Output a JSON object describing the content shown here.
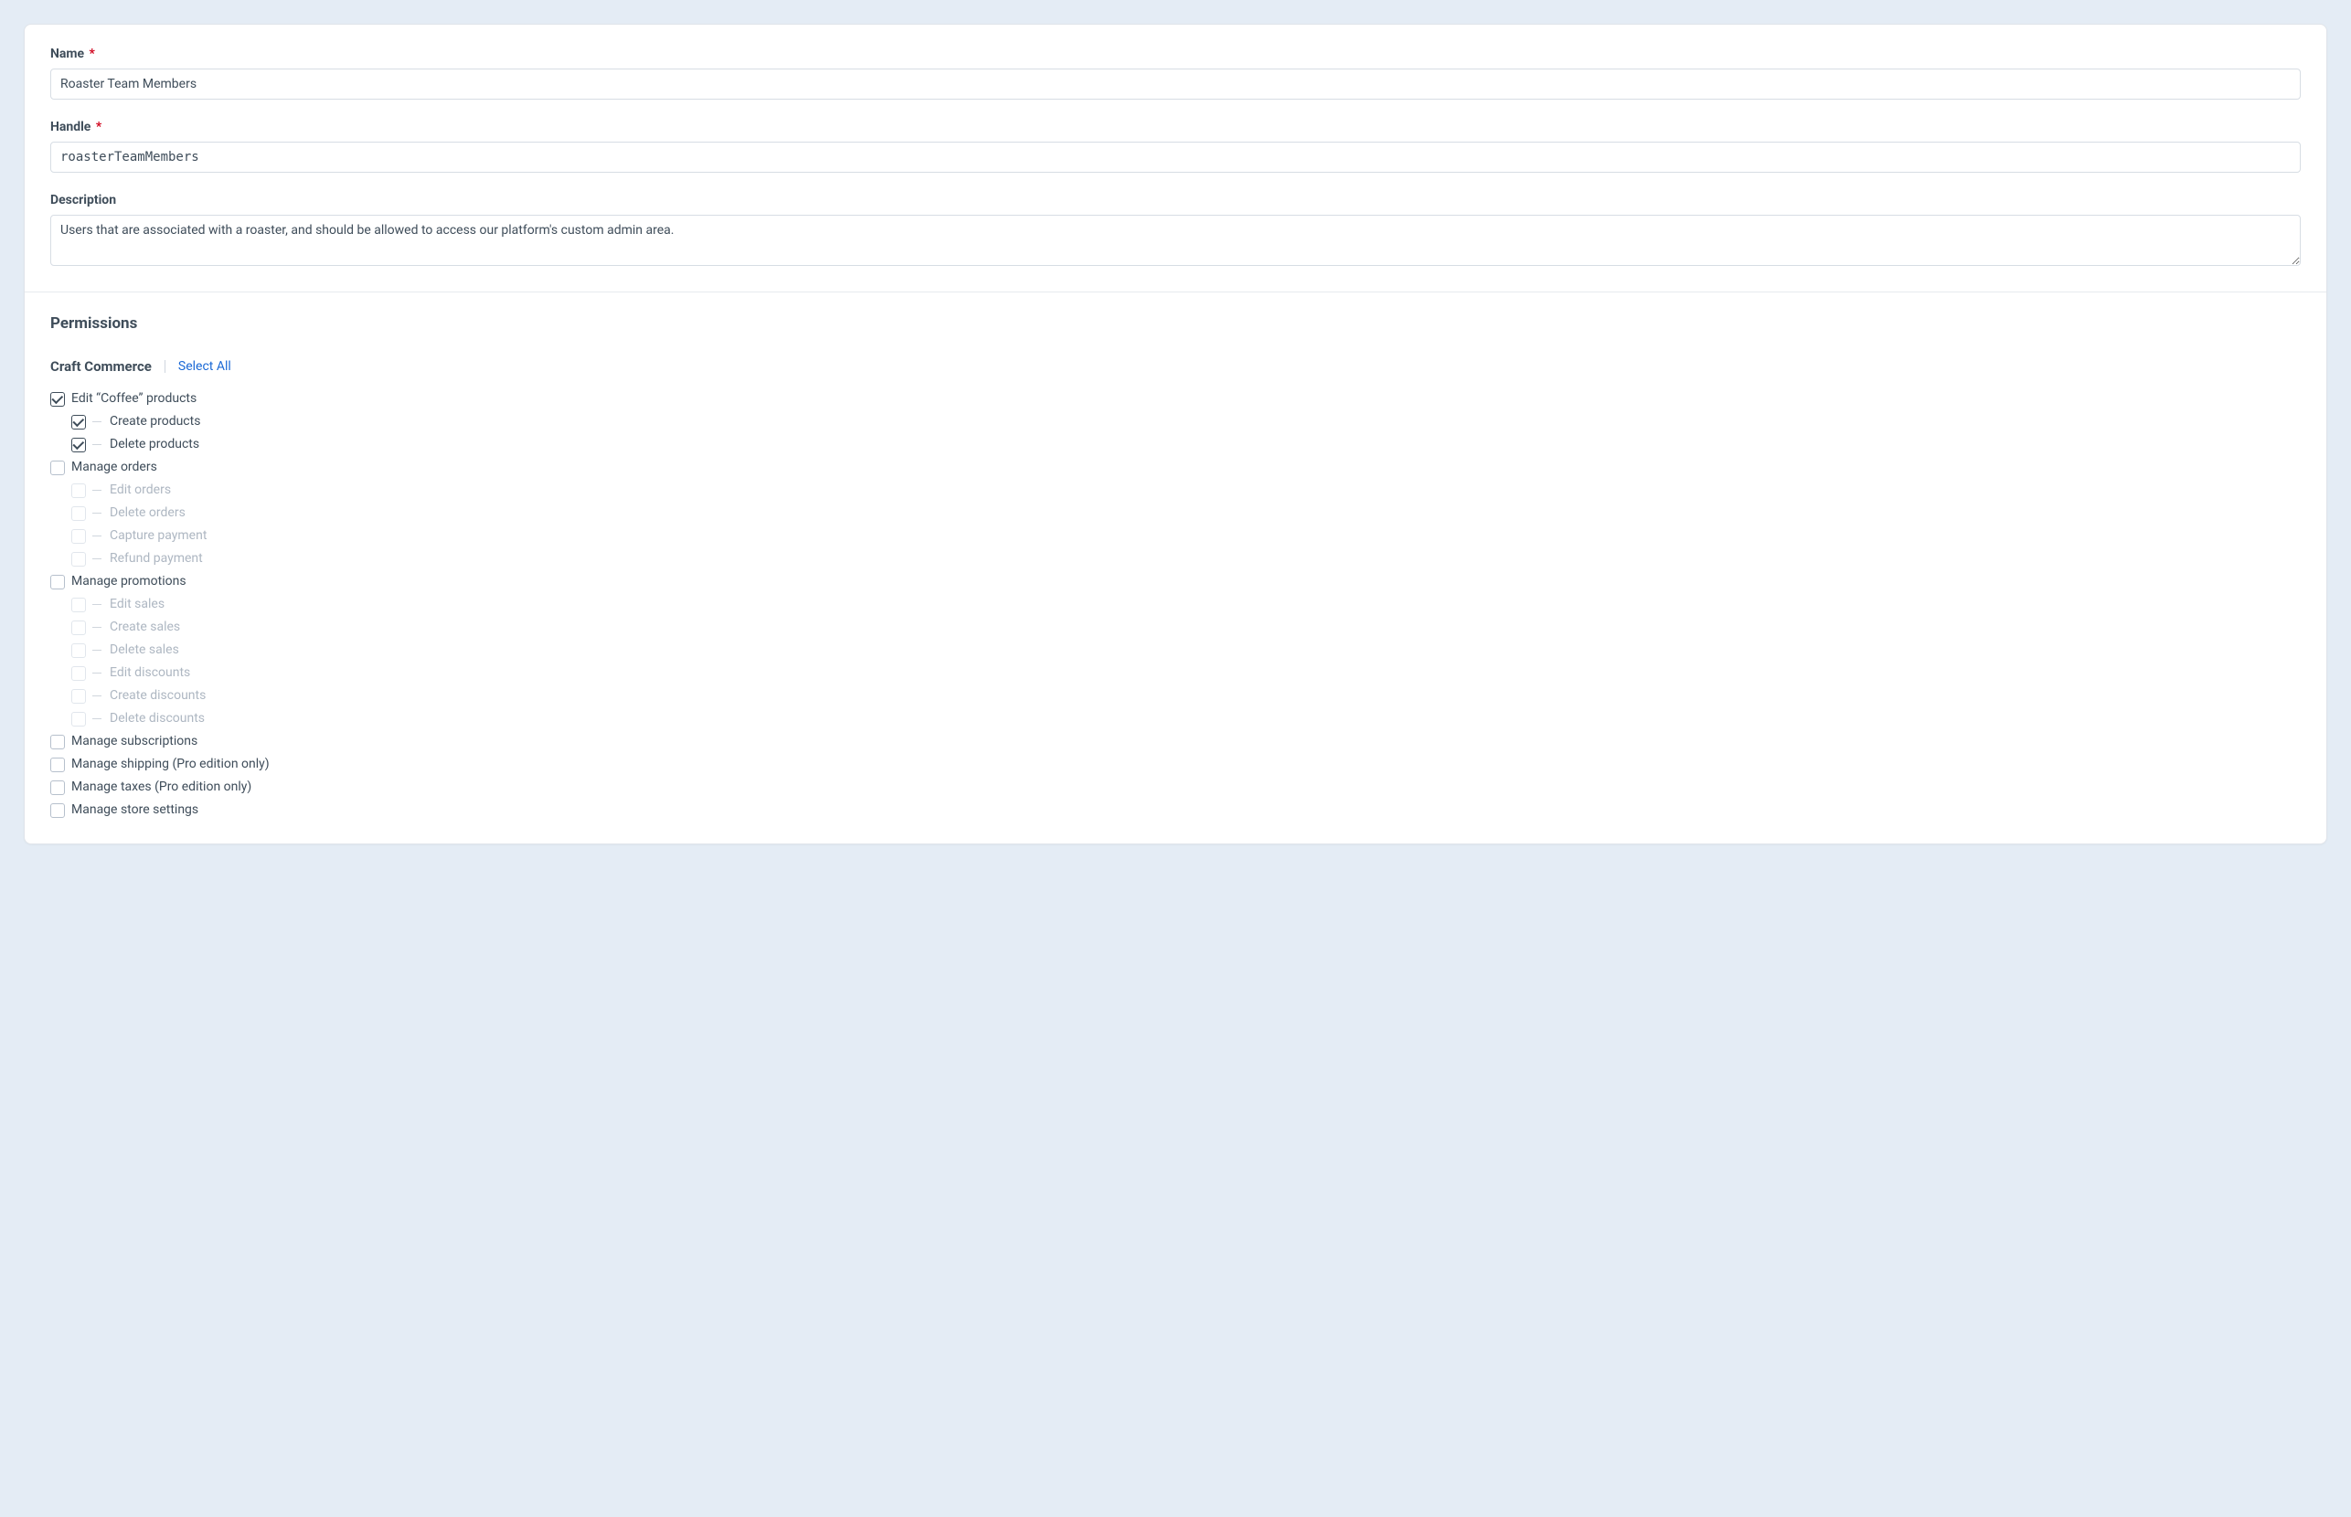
{
  "fields": {
    "name": {
      "label": "Name",
      "value": "Roaster Team Members",
      "required": true
    },
    "handle": {
      "label": "Handle",
      "value": "roasterTeamMembers",
      "required": true
    },
    "description": {
      "label": "Description",
      "value": "Users that are associated with a roaster, and should be allowed to access our platform's custom admin area."
    }
  },
  "permissions": {
    "heading": "Permissions",
    "group": "Craft Commerce",
    "select_all": "Select All",
    "items": {
      "edit_coffee": {
        "label": "Edit “Coffee” products",
        "checked": true,
        "disabled": false
      },
      "create_products": {
        "label": "Create products",
        "checked": true,
        "disabled": false
      },
      "delete_products": {
        "label": "Delete products",
        "checked": true,
        "disabled": false
      },
      "manage_orders": {
        "label": "Manage orders",
        "checked": false,
        "disabled": false
      },
      "edit_orders": {
        "label": "Edit orders",
        "checked": false,
        "disabled": true
      },
      "delete_orders": {
        "label": "Delete orders",
        "checked": false,
        "disabled": true
      },
      "capture_payment": {
        "label": "Capture payment",
        "checked": false,
        "disabled": true
      },
      "refund_payment": {
        "label": "Refund payment",
        "checked": false,
        "disabled": true
      },
      "manage_promotions": {
        "label": "Manage promotions",
        "checked": false,
        "disabled": false
      },
      "edit_sales": {
        "label": "Edit sales",
        "checked": false,
        "disabled": true
      },
      "create_sales": {
        "label": "Create sales",
        "checked": false,
        "disabled": true
      },
      "delete_sales": {
        "label": "Delete sales",
        "checked": false,
        "disabled": true
      },
      "edit_discounts": {
        "label": "Edit discounts",
        "checked": false,
        "disabled": true
      },
      "create_discounts": {
        "label": "Create discounts",
        "checked": false,
        "disabled": true
      },
      "delete_discounts": {
        "label": "Delete discounts",
        "checked": false,
        "disabled": true
      },
      "manage_subscriptions": {
        "label": "Manage subscriptions",
        "checked": false,
        "disabled": false
      },
      "manage_shipping": {
        "label": "Manage shipping (Pro edition only)",
        "checked": false,
        "disabled": false
      },
      "manage_taxes": {
        "label": "Manage taxes (Pro edition only)",
        "checked": false,
        "disabled": false
      },
      "manage_store_settings": {
        "label": "Manage store settings",
        "checked": false,
        "disabled": false
      }
    }
  },
  "required_glyph": "*"
}
